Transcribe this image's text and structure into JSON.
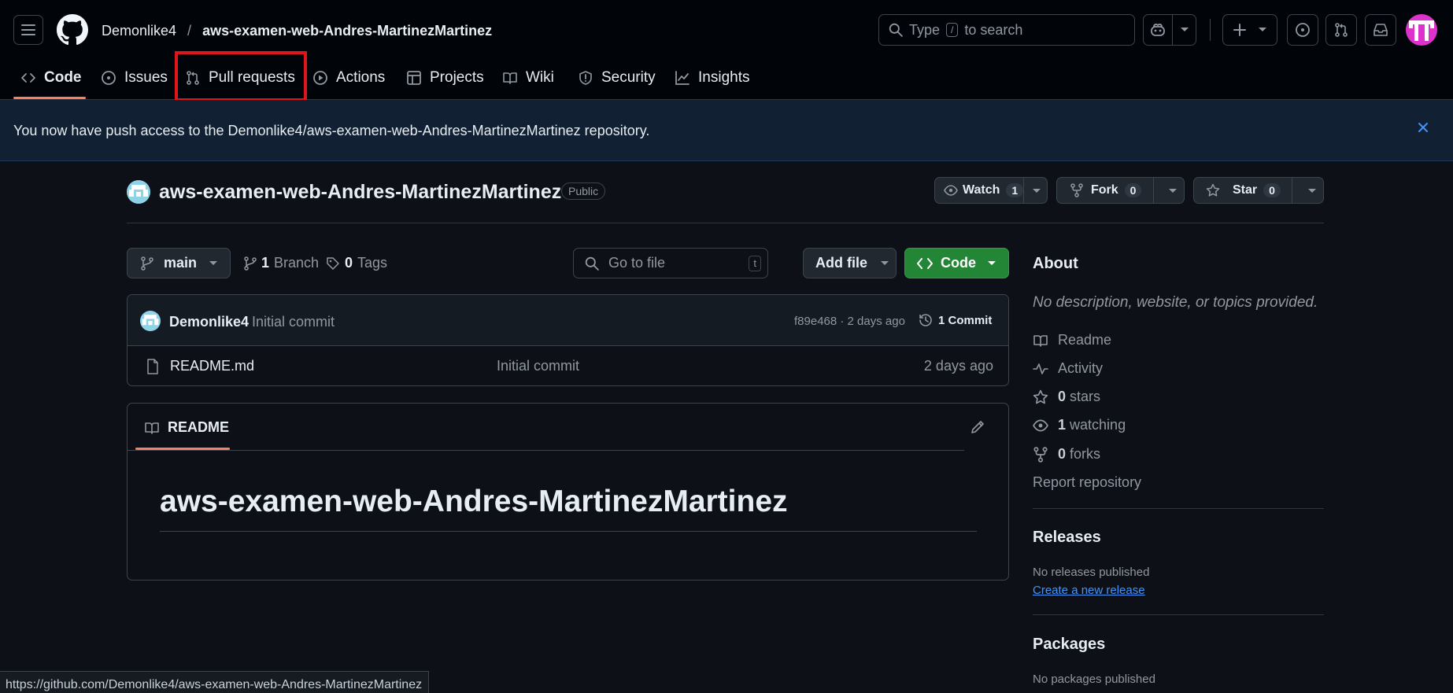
{
  "header": {
    "owner": "Demonlike4",
    "separator": "/",
    "repo": "aws-examen-web-Andres-MartinezMartinez",
    "search": {
      "prefix": "Type",
      "key": "/",
      "suffix": "to search"
    }
  },
  "nav": {
    "tabs": [
      {
        "label": "Code",
        "icon": "code-icon"
      },
      {
        "label": "Issues",
        "icon": "issue-icon"
      },
      {
        "label": "Pull requests",
        "icon": "pull-request-icon"
      },
      {
        "label": "Actions",
        "icon": "play-icon"
      },
      {
        "label": "Projects",
        "icon": "table-icon"
      },
      {
        "label": "Wiki",
        "icon": "book-icon"
      },
      {
        "label": "Security",
        "icon": "shield-icon"
      },
      {
        "label": "Insights",
        "icon": "graph-icon"
      }
    ]
  },
  "banner": {
    "message": "You now have push access to the Demonlike4/aws-examen-web-Andres-MartinezMartinez repository."
  },
  "repo_header": {
    "name": "aws-examen-web-Andres-MartinezMartinez",
    "visibility": "Public",
    "watch_label": "Watch",
    "watch_count": "1",
    "fork_label": "Fork",
    "fork_count": "0",
    "star_label": "Star",
    "star_count": "0"
  },
  "toolbar": {
    "branch": "main",
    "branch_count": "1",
    "branch_label": "Branch",
    "tag_count": "0",
    "tag_label": "Tags",
    "goto_placeholder": "Go to file",
    "goto_key": "t",
    "add_file": "Add file",
    "code": "Code"
  },
  "commit": {
    "author": "Demonlike4",
    "message": "Initial commit",
    "meta": "f89e468 · 2 days ago",
    "count_label": "1 Commit"
  },
  "files": [
    {
      "name": "README.md",
      "message": "Initial commit",
      "age": "2 days ago"
    }
  ],
  "readme": {
    "tab": "README",
    "heading": "aws-examen-web-Andres-MartinezMartinez"
  },
  "about": {
    "title": "About",
    "description": "No description, website, or topics provided.",
    "readme": "Readme",
    "activity": "Activity",
    "stars_count": "0",
    "stars_label": "stars",
    "watching_count": "1",
    "watching_label": "watching",
    "forks_count": "0",
    "forks_label": "forks",
    "report": "Report repository"
  },
  "releases": {
    "title": "Releases",
    "empty": "No releases published",
    "create": "Create a new release"
  },
  "packages": {
    "title": "Packages",
    "empty": "No packages published"
  },
  "status_bar": {
    "url": "https://github.com/Demonlike4/aws-examen-web-Andres-MartinezMartinez"
  },
  "colors": {
    "accent_tab": "#f78166",
    "highlight_box": "#e0151b",
    "code_button": "#238636",
    "link": "#4493f8",
    "avatar": "#dd33cc"
  }
}
